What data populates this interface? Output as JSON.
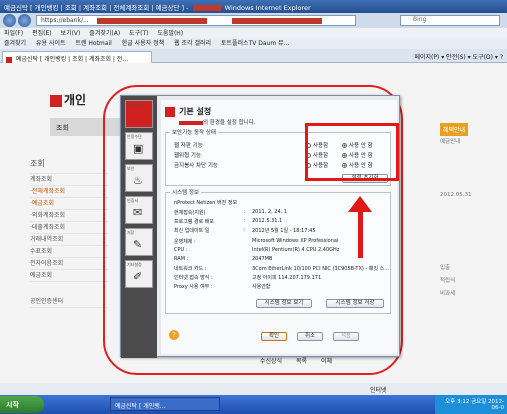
{
  "browser": {
    "title_prefix": "예금신탁 [ 개인뱅킹 | 조회 | 계좌조회 | 전체계좌조회 | 예금상단 ] -",
    "title_suffix": "Windows Internet Explorer",
    "address_url": "https://ebank/...",
    "search_placeholder": "Bing",
    "menu": [
      "파일(F)",
      "편집(E)",
      "보기(V)",
      "즐겨찾기(A)",
      "도구(T)",
      "도움말(H)"
    ],
    "favorites_label": "즐겨찾기",
    "favorites": [
      "유용 사이트",
      "트렌 Hotmail",
      "한글 사용자 정책",
      "웹 조각 갤러리",
      "토트플러스TV Daum 뮤..."
    ],
    "tab_title": "예금신탁 [ 개인뱅킹 | 조회 | 계좌조회 | 전...",
    "toolbar_right": "페이지(P) ▾  안전(S) ▾  도구(O) ▾  ?"
  },
  "page": {
    "header": "개인",
    "nav_label": "조회",
    "side_title": "조회",
    "side_items": [
      "계좌조회",
      "·전체계좌조회",
      "·예금조회",
      "·외화계좌조회",
      "·대출계좌조회",
      "거래내역조회",
      "수표조회",
      "전자어음조회",
      "예금조회",
      "공인인증센터"
    ],
    "right_badge": "혜택안내",
    "right_items": [
      "예금안내",
      "2012.05.31",
      "입출",
      "적립식",
      "비과세"
    ],
    "footer": [
      "수신상식",
      "목록",
      "이체"
    ]
  },
  "dialog": {
    "title": "기본 설정",
    "subtitle": "의 환경을 설정 합니다.",
    "sidebar": [
      "기본설정",
      "안정수단",
      "보안",
      "인증서",
      "저장",
      "기타설정"
    ],
    "options_group": "보안기능 동작 상태",
    "options": [
      {
        "name": "웹 자판 기능",
        "opt1": "사용함",
        "opt2": "사용 안 함",
        "selected": 2
      },
      {
        "name": "웹위협 기능",
        "opt1": "사용함",
        "opt2": "사용 안 함",
        "selected": 2
      },
      {
        "name": "금지봉사 차단 기능",
        "opt1": "사용함",
        "opt2": "사용 안 함",
        "selected": 2
      }
    ],
    "reset_button": "설정 초기화",
    "info_group": "시스템 정보",
    "info": [
      {
        "k": "nProtect Netizen 버전 정보",
        "v": ""
      },
      {
        "k": "현재접속(지원)",
        "v": "2011, 2, 24, 1"
      },
      {
        "k": "프로그램 경로 배포",
        "v": "2012.5.31.1"
      },
      {
        "k": "최신 업데이트 일",
        "v": "2012년 5월 1일 - 18:17:45"
      },
      {
        "k": "운영체제 :",
        "v": "Microsoft Windows XP Professional"
      },
      {
        "k": "CPU :",
        "v": "Intel(R) Pentium(R) 4 CPU 2.40GHz"
      },
      {
        "k": "RAM :",
        "v": "2047MB"
      },
      {
        "k": "네트워크 카드 :",
        "v": "3Com EtherLink 10/100 PCI NIC (3C905B-TX) - 패킷 스..."
      },
      {
        "k": "인터넷 접속 방식 :",
        "v": "고정 아이피    114.207.179.171"
      },
      {
        "k": "Proxy 사용 여부 :",
        "v": "사용안함"
      }
    ],
    "info_button1": "시스템 정보 보기",
    "info_button2": "시스템 정보 저장",
    "ok": "확인",
    "cancel": "취소",
    "apply": "적용"
  },
  "status_bar": "인터넷",
  "taskbar": {
    "start": "시작",
    "task": "예금신탁 [ 개인뱅...",
    "tray": "오후 3:12\n금요일\n2012-06-0"
  }
}
